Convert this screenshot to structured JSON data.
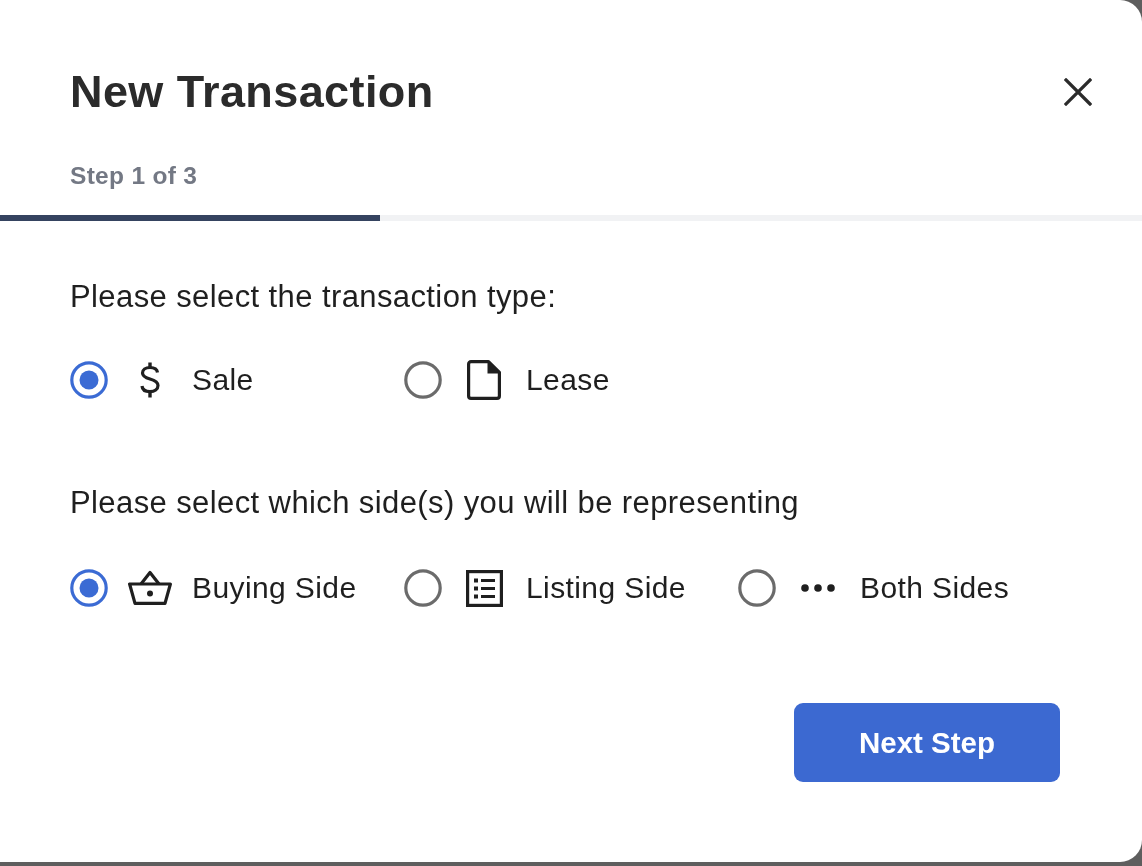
{
  "dialog": {
    "title": "New Transaction",
    "step": {
      "label": "Step 1 of 3",
      "level": 0.333
    },
    "sections": [
      {
        "prompt": "Please select the transaction type:",
        "options": [
          {
            "label": "Sale",
            "selected": true
          },
          {
            "label": "Lease",
            "selected": false
          }
        ]
      },
      {
        "prompt": "Please select which side(s) you will be representing",
        "options": [
          {
            "label": "Buying Side",
            "selected": true
          },
          {
            "label": "Listing Side",
            "selected": false
          },
          {
            "label": "Both Sides",
            "selected": false
          }
        ]
      }
    ],
    "primary_button": "Next Step"
  }
}
